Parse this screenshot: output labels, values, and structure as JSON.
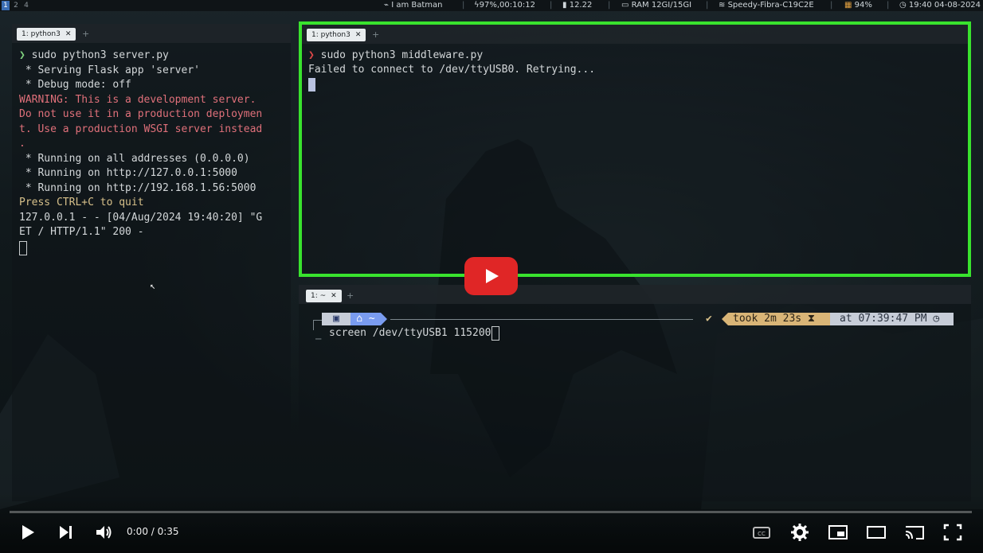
{
  "topbar": {
    "workspaces": [
      "1",
      "2",
      "4"
    ],
    "items": [
      {
        "icon": "bat-icon",
        "text": "I am Batman"
      },
      {
        "icon": "battery-icon",
        "text": "97%,00:10:12"
      },
      {
        "icon": "cpu-icon",
        "text": "12.22"
      },
      {
        "icon": "ram-icon",
        "text": "RAM 12GI/15GI"
      },
      {
        "icon": "wifi-icon",
        "text": "Speedy-Fibra-C19C2E"
      },
      {
        "icon": "signal-icon",
        "text": "94%"
      },
      {
        "icon": "clock-icon",
        "text": "19:40 04-08-2024"
      }
    ]
  },
  "left_pane": {
    "tab": "1: python3",
    "lines": [
      {
        "text": "❯ sudo python3 server.py",
        "style": "prompt"
      },
      {
        "text": " * Serving Flask app 'server'",
        "style": "normal"
      },
      {
        "text": " * Debug mode: off",
        "style": "normal"
      },
      {
        "text": "WARNING: This is a development server.",
        "style": "warn"
      },
      {
        "text": "Do not use it in a production deploymen",
        "style": "warn"
      },
      {
        "text": "t. Use a production WSGI server instead",
        "style": "warn"
      },
      {
        "text": ".",
        "style": "warn"
      },
      {
        "text": " * Running on all addresses (0.0.0.0)",
        "style": "normal"
      },
      {
        "text": " * Running on http://127.0.0.1:5000",
        "style": "normal"
      },
      {
        "text": " * Running on http://192.168.1.56:5000",
        "style": "normal"
      },
      {
        "text": "Press CTRL+C to quit",
        "style": "yellow"
      },
      {
        "text": "127.0.0.1 - - [04/Aug/2024 19:40:20] \"G",
        "style": "normal"
      },
      {
        "text": "ET / HTTP/1.1\" 200 -",
        "style": "normal"
      }
    ]
  },
  "right_top_pane": {
    "tab": "1: python3",
    "prompt_symbol": "❯",
    "command": "sudo python3 middleware.py",
    "output": "Failed to connect to /dev/ttyUSB0. Retrying..."
  },
  "right_bottom_pane": {
    "tab": "1: ~",
    "path": "~",
    "check": "✔",
    "took": "took 2m 23s",
    "at": "at 07:39:47 PM",
    "command": "screen /dev/ttyUSB1 115200"
  },
  "player": {
    "time": "0:00 / 0:35",
    "progress": 0,
    "colors": {
      "play_button": "#e02626",
      "highlight_border": "#39e32e"
    }
  }
}
